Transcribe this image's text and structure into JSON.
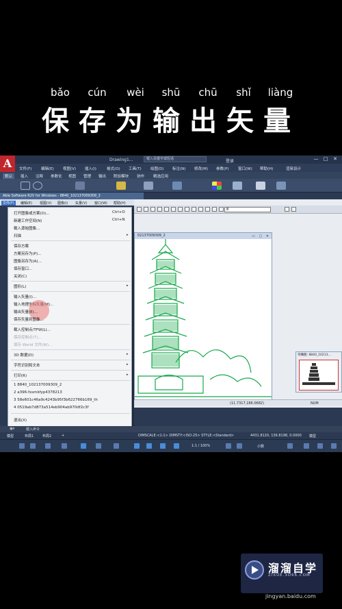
{
  "caption": {
    "title": "保存为输出矢量",
    "pinyin": [
      "bǎo",
      "cún",
      "wèi",
      "shū",
      "chū",
      "shǐ",
      "liàng"
    ]
  },
  "autocad": {
    "logo_letter": "A",
    "window_title": "Drawing1...",
    "search_placeholder": "键入关键字或短语",
    "user_label": "登录",
    "window_controls": [
      "—",
      "□",
      "✕"
    ],
    "menubar": [
      "文件(F)",
      "编辑(E)",
      "视图(V)",
      "插入(I)",
      "格式(O)",
      "工具(T)",
      "绘图(D)",
      "标注(N)",
      "修改(M)",
      "参数(P)",
      "窗口(W)",
      "帮助(H)",
      "渲染设计"
    ],
    "ribbon_tabs": [
      "默认",
      "插入",
      "注释",
      "参数化",
      "视图",
      "管理",
      "输出",
      "附加模块",
      "协作",
      "精选应用"
    ]
  },
  "able": {
    "window_title": "Able Software R2V for Windows - 8840_102137009309_2",
    "menubar": [
      "文件(F)",
      "编辑(E)",
      "视图(V)",
      "图像(I)",
      "矢量(V)",
      "窗口(W)",
      "帮助(H)"
    ],
    "layer_select": "8",
    "doc_title": "02137009309_2",
    "coord_readout": "(11.7317,186.0682)",
    "num_indicator": "NUM",
    "thumb_title": "鸟瞰图: 8840_10213..."
  },
  "file_menu": {
    "items": [
      {
        "label": "打开图像或方案(O)...",
        "shortcut": "Ctrl+O"
      },
      {
        "label": "新建工作空间(N)",
        "shortcut": "Ctrl+N"
      },
      {
        "label": "载入源始图像...",
        "shortcut": ""
      },
      {
        "label": "扫描",
        "shortcut": ""
      },
      {
        "label": "保存方案",
        "shortcut": ""
      },
      {
        "label": "方案另存为(P)...",
        "shortcut": ""
      },
      {
        "label": "图像另存为(A)...",
        "shortcut": ""
      },
      {
        "label": "保存窗口...",
        "shortcut": ""
      },
      {
        "label": "关闭(C)",
        "shortcut": ""
      },
      {
        "label": "图形(L)",
        "shortcut": ""
      },
      {
        "label": "输入矢量(I)...",
        "shortcut": ""
      },
      {
        "label": "输入地理坐标矢量(M)...",
        "shortcut": ""
      },
      {
        "label": "输出矢量(E)...",
        "shortcut": ""
      },
      {
        "label": "保存矢量到图像...",
        "shortcut": ""
      },
      {
        "label": "载入控制点/TFW(L)...",
        "shortcut": ""
      },
      {
        "label": "保存控制点(T)...",
        "shortcut": ""
      },
      {
        "label": "保存 World 文件(W)...",
        "shortcut": ""
      },
      {
        "label": "3D 数据(D)",
        "shortcut": ""
      },
      {
        "label": "字符识别和文本",
        "shortcut": ""
      },
      {
        "label": "打印(R)",
        "shortcut": ""
      },
      {
        "label": "1 8840_102137009309_2",
        "shortcut": ""
      },
      {
        "label": "2 a396-fxsmkfyp4378213",
        "shortcut": ""
      },
      {
        "label": "3 58e601c46a9c4243b95f3b622766b169_th",
        "shortcut": ""
      },
      {
        "label": "4 0519ab7d873a514eb904ab970df2c3f",
        "shortcut": ""
      },
      {
        "label": "退出(X)",
        "shortcut": ""
      }
    ]
  },
  "bottom": {
    "command_prompt": "键入命令",
    "model_tabs": [
      "模型",
      "布局1",
      "布局2",
      "+"
    ],
    "dim_status": "DIMSCALE:<1:1> DIMSTY:<ISO-25> STYLE:<Standard>",
    "coords": "4431.8120, 136.8198, 0.0000",
    "model_label": "模型",
    "scale": "1:1 / 100%",
    "units": "小数"
  },
  "watermark": {
    "name": "溜溜自学",
    "sub": "ZIXUE.3D66.COM"
  },
  "footer_url": "jingyan.baidu.com"
}
